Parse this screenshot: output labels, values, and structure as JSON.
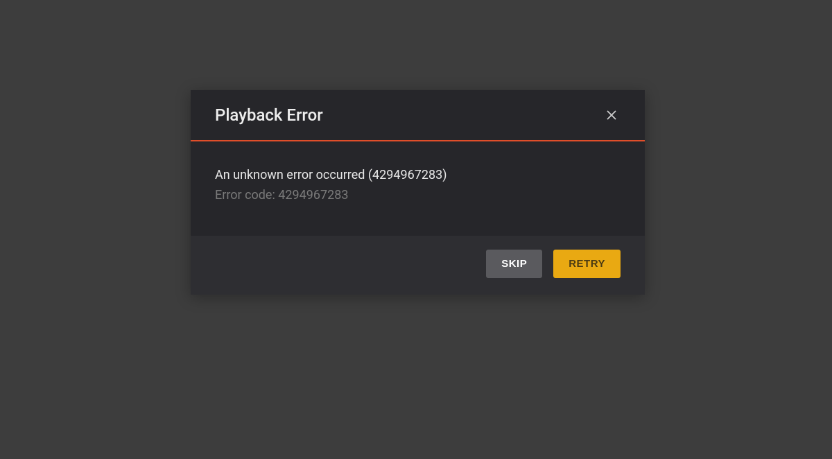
{
  "dialog": {
    "title": "Playback Error",
    "error_message": "An unknown error occurred (4294967283)",
    "error_code_label": "Error code: 4294967283",
    "buttons": {
      "skip": "SKIP",
      "retry": "RETRY"
    }
  }
}
